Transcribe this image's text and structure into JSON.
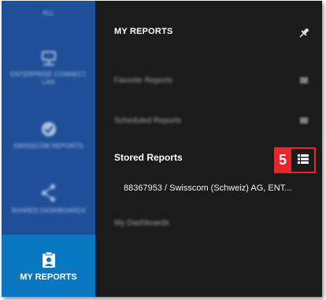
{
  "nav": {
    "items": [
      {
        "label": "ALL",
        "icon": "grid-icon",
        "blurred": true
      },
      {
        "label": "ENTERPRISE CONNECT LAN",
        "icon": "network-icon",
        "blurred": true
      },
      {
        "label": "SWISSCOM REPORTS",
        "icon": "check-circle-icon",
        "blurred": true
      },
      {
        "label": "SHARED DASHBOARDS",
        "icon": "share-icon",
        "blurred": true
      },
      {
        "label": "MY REPORTS",
        "icon": "clipboard-user-icon",
        "blurred": false,
        "active": true
      }
    ]
  },
  "panel": {
    "title": "MY REPORTS",
    "pin_icon": "pin-icon",
    "favorite": {
      "label": "Favorite Reports"
    },
    "scheduled": {
      "label": "Scheduled Reports"
    },
    "stored": {
      "label": "Stored Reports",
      "icon": "list-icon"
    },
    "stored_item": "88367953 / Swisscom (Schweiz) AG, ENT...",
    "dashboards": {
      "label": "My Dashboards"
    }
  },
  "annotation": {
    "number": "5",
    "color": "#e5262b"
  },
  "colors": {
    "rail": "#1f4f99",
    "rail_active": "#0a77c2",
    "panel": "#1b1b1b"
  }
}
